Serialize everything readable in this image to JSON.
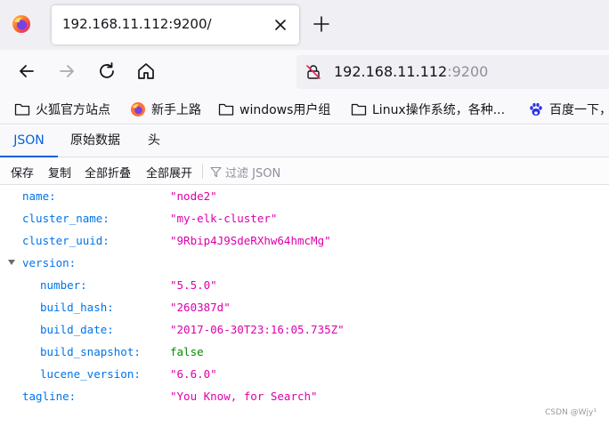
{
  "browser": {
    "tab_title": "192.168.11.112:9200/",
    "url_host": "192.168.11.112",
    "url_port": ":9200"
  },
  "bookmarks": [
    {
      "label": "火狐官方站点",
      "icon": "folder-icon"
    },
    {
      "label": "新手上路",
      "icon": "firefox-icon"
    },
    {
      "label": "windows用户组",
      "icon": "folder-icon"
    },
    {
      "label": "Linux操作系统，各种...",
      "icon": "folder-icon"
    },
    {
      "label": "百度一下，",
      "icon": "baidu-paw-icon"
    }
  ],
  "json_viewer": {
    "tabs": [
      "JSON",
      "原始数据",
      "头"
    ],
    "active_tab": "JSON",
    "toolbar": {
      "save": "保存",
      "copy": "复制",
      "collapse_all": "全部折叠",
      "expand_all": "全部展开",
      "filter_placeholder": "过滤 JSON"
    },
    "rows": [
      {
        "key": "name:",
        "value": "\"node2\"",
        "type": "str"
      },
      {
        "key": "cluster_name:",
        "value": "\"my-elk-cluster\"",
        "type": "str"
      },
      {
        "key": "cluster_uuid:",
        "value": "\"9Rbip4J9SdeRXhw64hmcMg\"",
        "type": "str"
      },
      {
        "key": "version:",
        "value": "",
        "type": "object"
      },
      {
        "key": "number:",
        "value": "\"5.5.0\"",
        "type": "str"
      },
      {
        "key": "build_hash:",
        "value": "\"260387d\"",
        "type": "str"
      },
      {
        "key": "build_date:",
        "value": "\"2017-06-30T23:16:05.735Z\"",
        "type": "str"
      },
      {
        "key": "build_snapshot:",
        "value": "false",
        "type": "bool"
      },
      {
        "key": "lucene_version:",
        "value": "\"6.6.0\"",
        "type": "str"
      },
      {
        "key": "tagline:",
        "value": "\"You Know, for Search\"",
        "type": "str"
      }
    ]
  },
  "watermark": "CSDN @Wjy¹",
  "colors": {
    "accent": "#0061e0",
    "json_key": "#0074e8",
    "json_string": "#dd00a9",
    "json_bool": "#058b00"
  }
}
